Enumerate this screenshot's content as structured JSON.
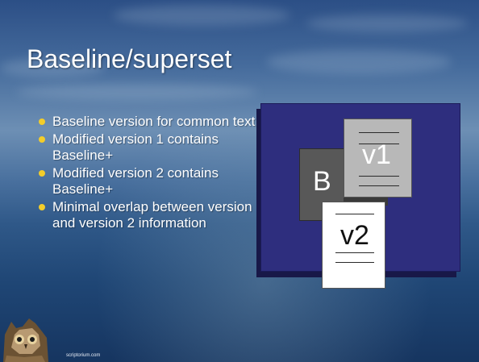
{
  "slide": {
    "title": "Baseline/superset",
    "bullets": [
      "Baseline version for common text",
      "Modified version 1 contains Baseline+",
      "Modified version 2 contains Baseline+",
      "Minimal overlap between version 1 and version 2 information"
    ],
    "bullet_color": "#f3cd2a",
    "diagram": {
      "panel_color": "#2e2e7e",
      "docs": [
        {
          "label": "B"
        },
        {
          "label": "v1"
        },
        {
          "label": "v2"
        }
      ]
    },
    "footer": "scriptorium.com",
    "owl_icon": "owl-logo-icon"
  }
}
